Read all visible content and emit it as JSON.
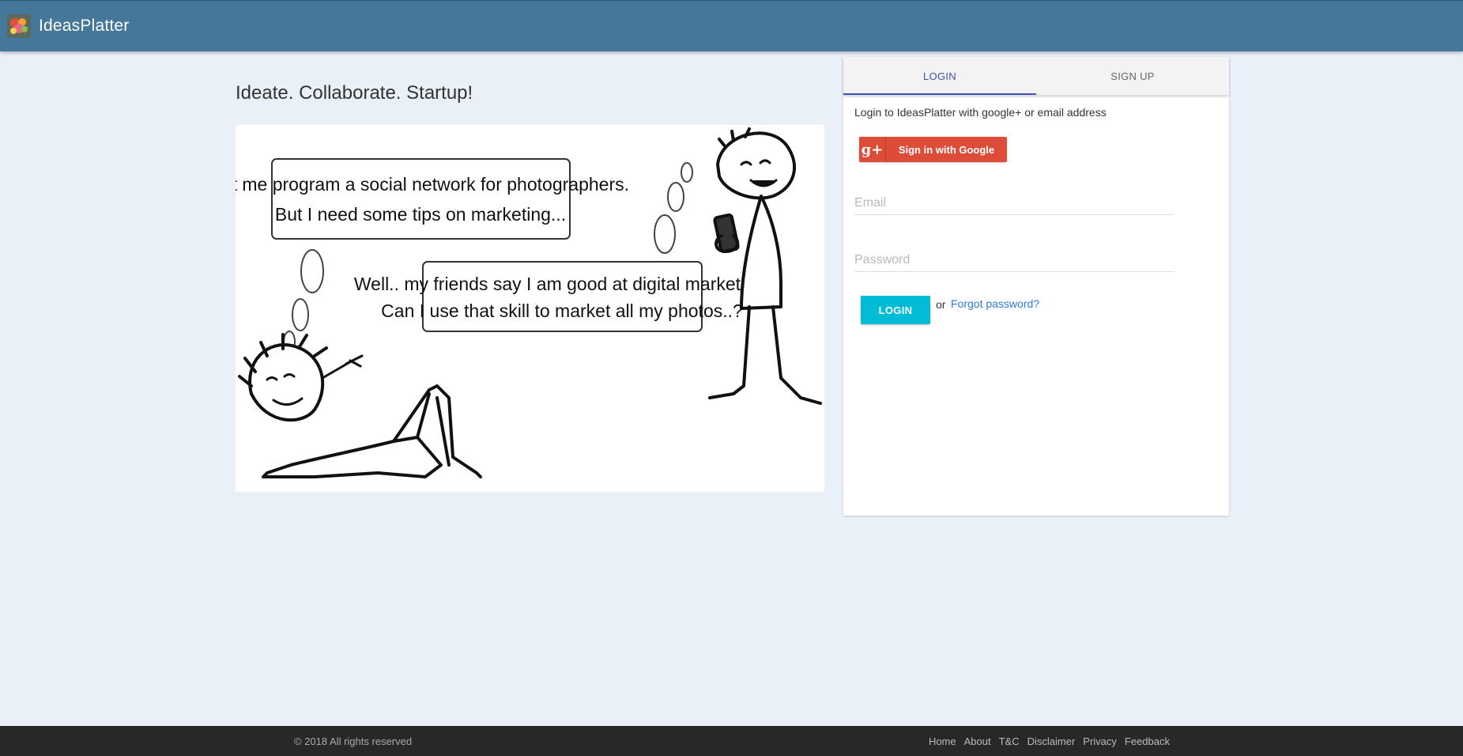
{
  "header": {
    "brand": "IdeasPlatter",
    "logo_icon": "ideasplatter-logo-icon",
    "bg_color": "#44779a"
  },
  "hero": {
    "tagline": "Ideate. Collaborate. Startup!",
    "illustration": {
      "bubble_1_line_1": "Let me program a social network for photographers.",
      "bubble_1_line_2": "But I need some tips on marketing...",
      "bubble_2_line_1": "Well.. my friends say I am good at digital marketing.",
      "bubble_2_line_2": "Can I use that skill to market all my photos..?"
    }
  },
  "auth": {
    "tabs": [
      {
        "label": "LOGIN",
        "active": true
      },
      {
        "label": "SIGN UP",
        "active": false
      }
    ],
    "intro": "Login to IdeasPlatter with google+ or email address",
    "google_button": {
      "icon": "g+",
      "label": "Sign in with Google",
      "color": "#dd4b39"
    },
    "email": {
      "placeholder": "Email",
      "value": ""
    },
    "password": {
      "placeholder": "Password",
      "value": ""
    },
    "login_label": "LOGIN",
    "or_text": "or",
    "forgot_label": "Forgot password?",
    "accent_color": "#3f51b5",
    "login_color": "#00bcd4"
  },
  "footer": {
    "copyright": "© 2018 All rights reserved",
    "links": [
      "Home",
      "About",
      "T&C",
      "Disclaimer",
      "Privacy",
      "Feedback"
    ]
  }
}
